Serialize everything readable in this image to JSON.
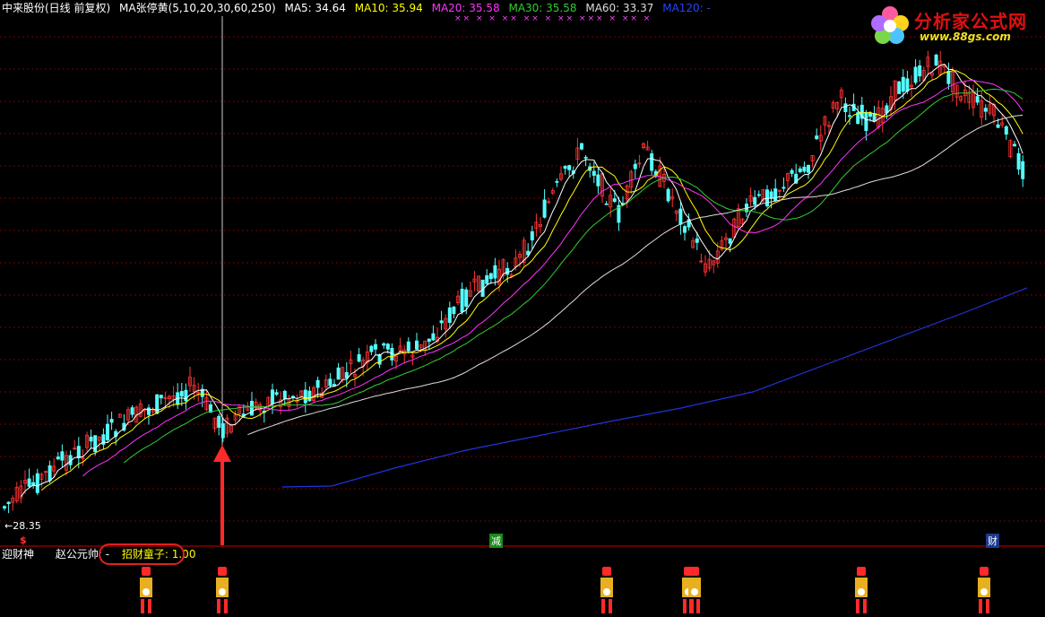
{
  "header": {
    "stock_label": "中来股份(日线 前复权)",
    "indicator_label": "MA张停黄(5,10,20,30,60,250)",
    "ma": [
      {
        "label": "MA5: 34.64",
        "color": "#ffffff"
      },
      {
        "label": "MA10: 35.94",
        "color": "#ffff00"
      },
      {
        "label": "MA20: 35.58",
        "color": "#ff33ff"
      },
      {
        "label": "MA30: 35.58",
        "color": "#33cc33"
      },
      {
        "label": "MA60: 33.37",
        "color": "#dddddd"
      },
      {
        "label": "MA120: -",
        "color": "#2244ff"
      }
    ]
  },
  "logo": {
    "title": "分析家公式网",
    "url": "www.88gs.com"
  },
  "price_marker": "←28.35",
  "top_marks": "×× × × ×× ×× × ×× ××× × ×× ×",
  "signals": {
    "s_mark": "$",
    "jian": "减",
    "cai": "财"
  },
  "sub_panel": {
    "title": "迎财神",
    "f1": "赵公元帅: -",
    "f2": "招财童子: 1.00"
  },
  "colors": {
    "up": "#ff3333",
    "down": "#55ffff",
    "ma120": "#2233dd",
    "grid": "#770000"
  },
  "chart_data": {
    "type": "candlestick",
    "title": "中来股份(日线 前复权)",
    "series": [
      {
        "name": "MA5",
        "last": 34.64
      },
      {
        "name": "MA10",
        "last": 35.94
      },
      {
        "name": "MA20",
        "last": 35.58
      },
      {
        "name": "MA30",
        "last": 35.58
      },
      {
        "name": "MA60",
        "last": 33.37
      },
      {
        "name": "MA120",
        "last": null
      }
    ],
    "annotations": [
      "←28.35",
      "减",
      "财"
    ],
    "mascot_count": 8
  }
}
